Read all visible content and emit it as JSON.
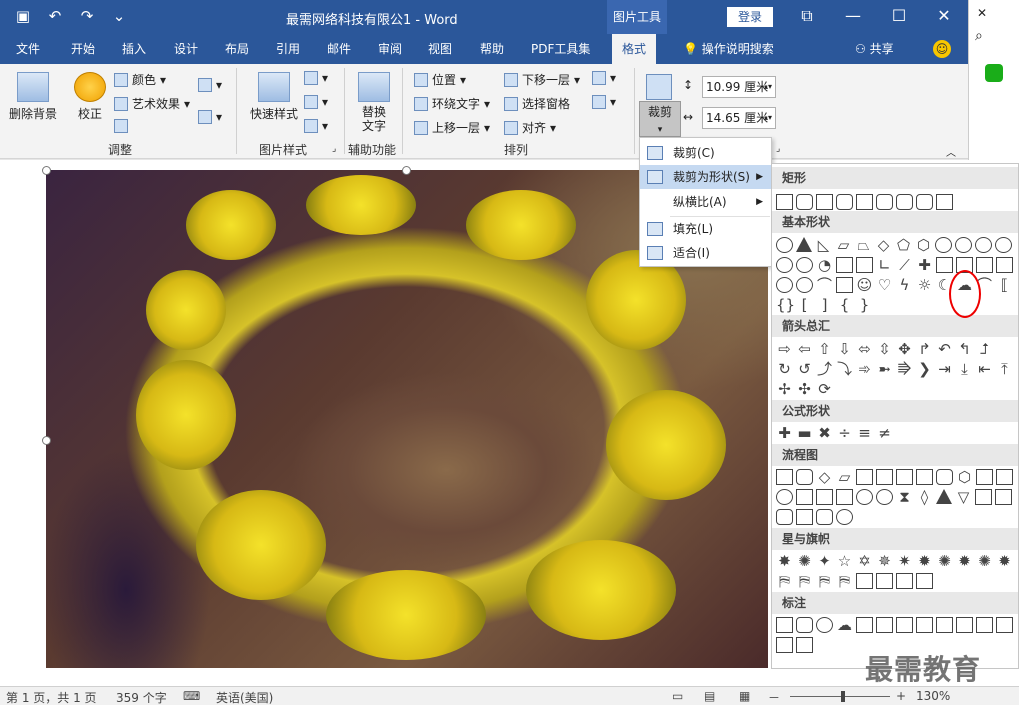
{
  "titlebar": {
    "doc_title": "最需网络科技有限公1 - Word",
    "tools_tab": "图片工具",
    "login": "登录",
    "icons": [
      "save-icon",
      "undo-icon",
      "redo-icon",
      "customize-icon"
    ],
    "window_icons": [
      "ribbon-display-icon",
      "minimize-icon",
      "maximize-icon",
      "close-icon"
    ]
  },
  "tabs": {
    "items": [
      "文件",
      "开始",
      "插入",
      "设计",
      "布局",
      "引用",
      "邮件",
      "审阅",
      "视图",
      "帮助",
      "PDF工具集",
      "格式"
    ],
    "active": "格式",
    "tell_me": "操作说明搜索",
    "share": "共享"
  },
  "ribbon": {
    "remove_bg": "删除背景",
    "corrections": "校正",
    "color": "颜色",
    "artistic": "艺术效果",
    "adjust_group": "调整",
    "quick_styles": "快速样式",
    "picture_styles_group": "图片样式",
    "alt_text": "替换\n文字",
    "alt_text_line1": "替换",
    "alt_text_line2": "文字",
    "accessibility_group": "辅助功能",
    "position": "位置",
    "wrap_text": "环绕文字",
    "bring_forward": "上移一层",
    "send_backward": "下移一层",
    "selection_pane": "选择窗格",
    "align": "对齐",
    "arrange_group": "排列",
    "crop": "裁剪",
    "height": "10.99 厘米",
    "width": "14.65 厘米"
  },
  "crop_menu": {
    "items": [
      {
        "label": "裁剪(C)"
      },
      {
        "label": "裁剪为形状(S)"
      },
      {
        "label": "纵横比(A)"
      },
      {
        "label": "填充(L)"
      },
      {
        "label": "适合(I)"
      }
    ]
  },
  "shapes_gallery": {
    "sections": [
      "矩形",
      "基本形状",
      "箭头总汇",
      "公式形状",
      "流程图",
      "星与旗帜",
      "标注"
    ]
  },
  "statusbar": {
    "page": "第 1 页，共 1 页",
    "words": "359 个字",
    "language": "英语(美国)",
    "zoom": "130%",
    "minus": "－",
    "plus": "+"
  },
  "watermark": "最需教育"
}
